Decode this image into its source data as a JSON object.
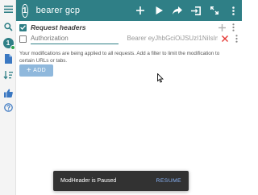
{
  "header": {
    "profile_number": "1",
    "title": "bearer gcp"
  },
  "sidebar": {
    "profile_number": "1"
  },
  "section": {
    "title": "Request headers"
  },
  "request_header": {
    "name": "Authorization",
    "value": "Bearer eyJhbGciOiJSUzI1NiIsImt"
  },
  "info": {
    "text": "Your modifications are being applied to all requests. Add a filter to limit the modification to certain URLs or tabs."
  },
  "add_button": {
    "label": "ADD"
  },
  "snackbar": {
    "message": "ModHeader is Paused",
    "action": "RESUME"
  },
  "colors": {
    "primary": "#2f7f86",
    "add_button": "#8fb8dc",
    "snackbar_bg": "#323232",
    "snackbar_action": "#8ab4f8",
    "delete": "#e53935"
  }
}
